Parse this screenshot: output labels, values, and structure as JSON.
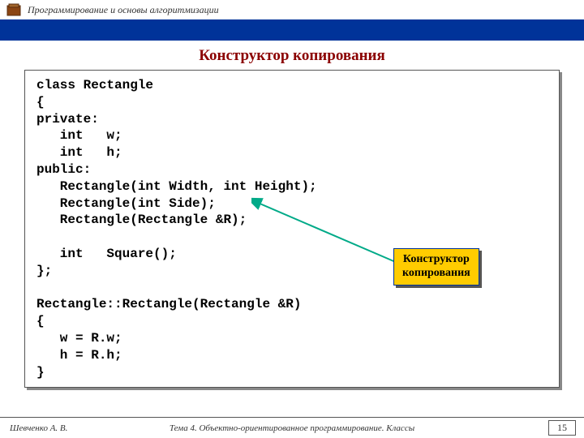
{
  "header": {
    "course_title": "Программирование и основы алгоритмизации"
  },
  "slide": {
    "title": "Конструктор копирования",
    "code": "class Rectangle\n{\nprivate:\n   int   w;\n   int   h;\npublic:\n   Rectangle(int Width, int Height);\n   Rectangle(int Side);\n   Rectangle(Rectangle &R);\n\n   int   Square();\n};\n\nRectangle::Rectangle(Rectangle &R)\n{\n   w = R.w;\n   h = R.h;\n}"
  },
  "callout": {
    "line1": "Конструктор",
    "line2": "копирования"
  },
  "footer": {
    "author": "Шевченко А. В.",
    "topic": "Тема 4. Объектно-ориентированное программирование. Классы",
    "page": "15"
  },
  "colors": {
    "title": "#8b0000",
    "strip": "#003399",
    "callout_bg": "#ffcc00",
    "arrow": "#00aa88"
  }
}
